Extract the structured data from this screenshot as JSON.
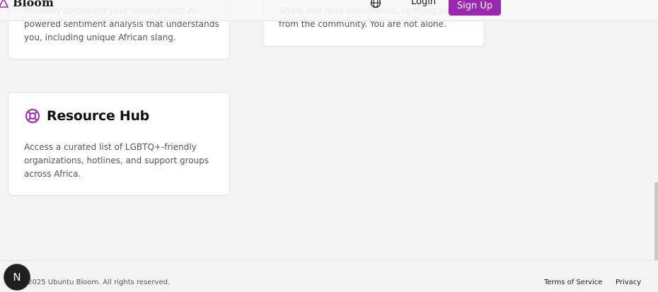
{
  "header": {
    "brand": "Bloom",
    "login_label": "Login",
    "signup_label": "Sign Up",
    "icons": {
      "logo": "triangle-logo-icon",
      "language": "globe-icon"
    },
    "accent_color": "#9b27b0"
  },
  "cards": [
    {
      "description": "Privately document your feelings with AI-powered sentiment analysis that understands you, including unique African slang."
    },
    {
      "description": "Share and read anonymous, uplifting stories from the community. You are not alone."
    },
    {
      "icon": "lifebuoy-icon",
      "title": "Resource Hub",
      "description": "Access a curated list of LGBTQ+-friendly organizations, hotlines, and support groups across Africa."
    }
  ],
  "footer": {
    "copyright": "© 2025 Ubuntu Bloom. All rights reserved.",
    "terms_label": "Terms of Service",
    "privacy_label": "Privacy"
  },
  "dev_badge": {
    "label": "N"
  }
}
